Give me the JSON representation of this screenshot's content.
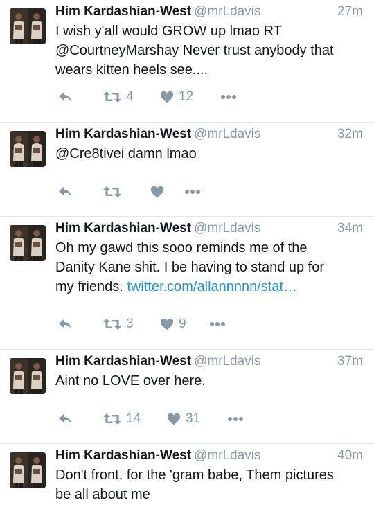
{
  "author": {
    "name": "Him Kardashian-West",
    "handle": "@mrLdavis"
  },
  "tweets": [
    {
      "time": "27m",
      "lines": [
        "I wish y'all would GROW up lmao RT",
        "@CourtneyMarshay Never trust anybody that",
        "wears kitten heels see...."
      ],
      "retweets": "4",
      "likes": "12"
    },
    {
      "time": "32m",
      "lines": [
        "@Cre8tivei damn lmao"
      ],
      "retweets": "",
      "likes": ""
    },
    {
      "time": "34m",
      "lines": [
        "Oh my gawd this sooo reminds me of the",
        "Danity Kane shit. I be having to stand up for"
      ],
      "line3_prefix": "my friends.",
      "link": "twitter.com/allannnnn/stat…",
      "retweets": "3",
      "likes": "9"
    },
    {
      "time": "37m",
      "lines": [
        "Aint no LOVE over here."
      ],
      "retweets": "14",
      "likes": "31"
    },
    {
      "time": "40m",
      "lines": [
        "Don't front, for the 'gram babe, Them pictures",
        "be all about me"
      ]
    }
  ],
  "icons": {
    "reply": "reply-icon",
    "retweet": "retweet-icon",
    "like": "heart-icon",
    "more": "more-icon"
  },
  "colors": {
    "text": "#14171a",
    "muted": "#8899a6",
    "link": "#1b95e0",
    "divider": "#e1e8ed"
  }
}
